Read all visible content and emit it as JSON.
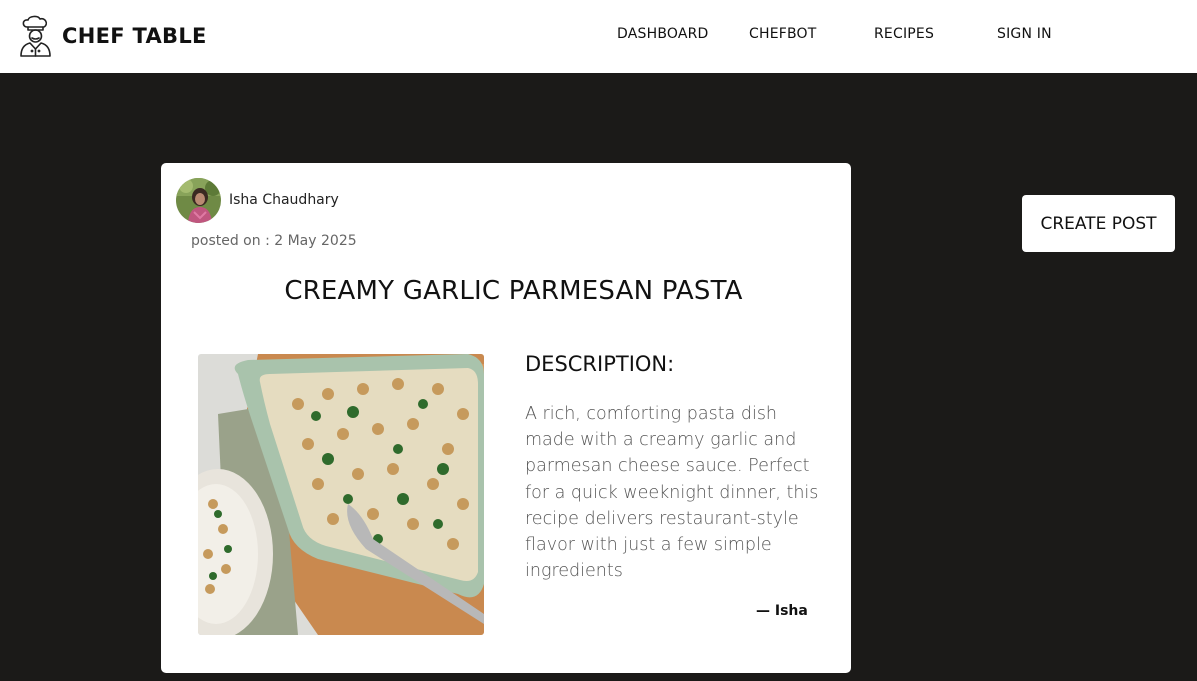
{
  "brand": {
    "name": "CHEF TABLE",
    "logo_icon": "chef-icon"
  },
  "nav": {
    "links": [
      {
        "label": "DASHBOARD"
      },
      {
        "label": "CHEFBOT"
      },
      {
        "label": "RECIPES"
      },
      {
        "label": "SIGN IN"
      }
    ]
  },
  "actions": {
    "create_post_label": "CREATE POST"
  },
  "post": {
    "author": "Isha Chaudhary",
    "posted_prefix": "posted on :",
    "posted_date": "2 May 2025",
    "title": "CREAMY GARLIC PARMESAN PASTA",
    "description_heading": "DESCRIPTION:",
    "description": "A rich, comforting pasta dish made with a creamy garlic and parmesan cheese sauce. Perfect for a quick weeknight dinner, this recipe delivers restaurant-style flavor with just a few simple ingredients",
    "signature": "— Isha"
  },
  "colors": {
    "page_bg": "#1b1a18",
    "card_bg": "#ffffff",
    "navbar_bg": "#ffffff"
  }
}
